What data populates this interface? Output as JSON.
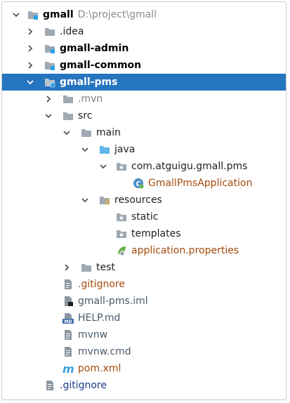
{
  "tree": {
    "root": {
      "name": "gmall",
      "path": "D:\\project\\gmall"
    },
    "idea": ".idea",
    "gmall_admin": "gmall-admin",
    "gmall_common": "gmall-common",
    "gmall_pms": "gmall-pms",
    "mvn": ".mvn",
    "src": "src",
    "main": "main",
    "java": "java",
    "package": "com.atguigu.gmall.pms",
    "app_class": "GmallPmsApplication",
    "resources": "resources",
    "static": "static",
    "templates": "templates",
    "app_props": "application.properties",
    "test": "test",
    "gitignore_pms": ".gitignore",
    "iml": "gmall-pms.iml",
    "help": "HELP.md",
    "mvnw": "mvnw",
    "mvnw_cmd": "mvnw.cmd",
    "pom": "pom.xml",
    "gitignore_root": ".gitignore"
  },
  "colors": {
    "selected": "#2675bf",
    "folder": "#9fa9b3",
    "module_badge": "#2aa2e6",
    "java_folder": "#5fb6ea",
    "changed_file": "#a44a0b",
    "vcs_blue": "#1c3b8f"
  }
}
